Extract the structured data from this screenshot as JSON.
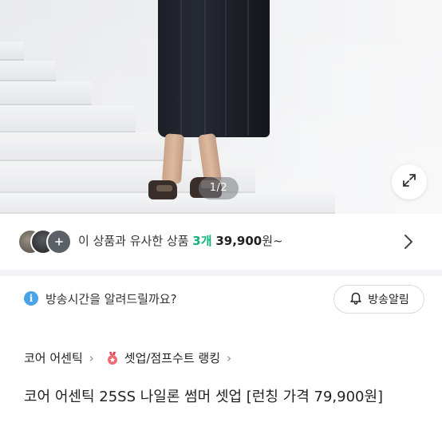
{
  "gallery": {
    "counter": "1/2",
    "expand_icon": "expand-diagonal-icon"
  },
  "similar": {
    "text_prefix": "이 상품과 유사한 상품",
    "count": "3개",
    "price": "39,900",
    "suffix": "원~",
    "chevron_icon": "chevron-right-icon",
    "thumb_more_icon": "plus-icon"
  },
  "broadcast": {
    "info_icon": "info-icon",
    "question": "방송시간을 알려드릴까요?",
    "button_label": "방송알림",
    "bell_icon": "bell-icon"
  },
  "breadcrumb": {
    "brand": "코어 어센틱",
    "ranking": "셋업/점프수트 랭킹"
  },
  "product": {
    "title": "코어 어센틱 25SS 나일론 썸머 셋업 [런칭 가격 79,900원]"
  },
  "colors": {
    "accent_green": "#13b27b",
    "info_blue": "#4aa3e6",
    "divider": "#f2f3f5"
  }
}
